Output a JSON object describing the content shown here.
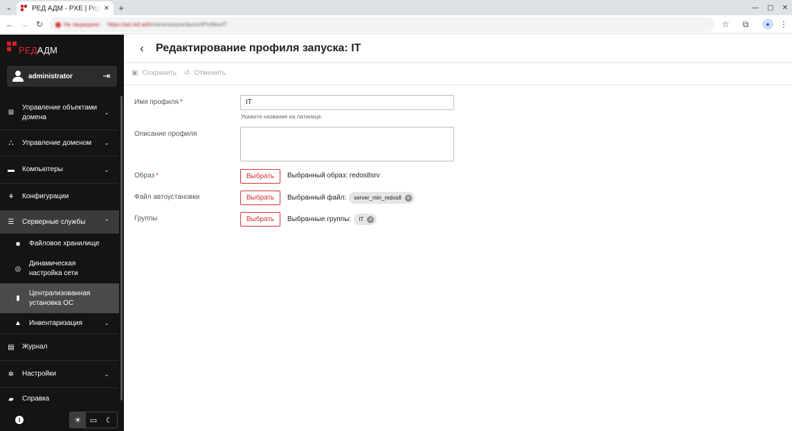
{
  "browser": {
    "tab_title": "РЕД АДМ - PXE | Редактирование профиля запуска",
    "tab_close": "✕",
    "new_tab": "+",
    "omnibox_security": "Не защищено",
    "url_host": "https://ad.red.adm",
    "url_path": "/services/pxe/launchProfiles/IT"
  },
  "sidebar": {
    "logo_red": "РЕД",
    "logo_white": "АДМ",
    "user": "administrator",
    "menu": [
      {
        "label": "Управление объектами домена",
        "icon": "domain-objects-icon",
        "chevron": "⌄"
      },
      {
        "label": "Управление доменом",
        "icon": "domain-tree-icon",
        "chevron": "⌄"
      },
      {
        "label": "Компьютеры",
        "icon": "monitor-icon",
        "chevron": "⌄"
      },
      {
        "label": "Конфигурации",
        "icon": "configuration-icon",
        "chevron": ""
      },
      {
        "label": "Серверные службы",
        "icon": "server-list-icon",
        "chevron": "⌃"
      },
      {
        "label": "Файловое хранилище",
        "icon": "folder-icon",
        "chevron": ""
      },
      {
        "label": "Динамическая настройка сети",
        "icon": "network-signal-icon",
        "chevron": ""
      },
      {
        "label": "Централизованная установка ОС",
        "icon": "os-install-icon",
        "chevron": ""
      },
      {
        "label": "Инвентаризация",
        "icon": "inventory-icon",
        "chevron": "⌄"
      },
      {
        "label": "Журнал",
        "icon": "journal-icon",
        "chevron": ""
      },
      {
        "label": "Настройки",
        "icon": "gear-icon",
        "chevron": "⌄"
      },
      {
        "label": "Справка",
        "icon": "book-icon",
        "chevron": ""
      }
    ]
  },
  "page": {
    "title": "Редактирование профиля запуска: IT",
    "save": "Сохранить",
    "cancel": "Отменить"
  },
  "form": {
    "name_label": "Имя профиля",
    "name_value": "IT",
    "name_hint": "Укажите название на латинице.",
    "desc_label": "Описание профиля",
    "image_label": "Образ",
    "image_select": "Выбрать",
    "image_selected_label": "Выбранный образ:",
    "image_selected_value": "redos8srv",
    "autoinstall_label": "Файл автоустановки",
    "autoinstall_select": "Выбрать",
    "autoinstall_selected_label": "Выбранный файл:",
    "autoinstall_chip": "server_min_redos8",
    "groups_label": "Группы",
    "groups_select": "Выбрать",
    "groups_selected_label": "Выбранные группы:",
    "groups_chip": "IT",
    "required_mark": "*"
  },
  "colors": {
    "accent": "#d32f2f",
    "sidebar_bg": "#141414",
    "sidebar_active": "#3b3b3b"
  }
}
